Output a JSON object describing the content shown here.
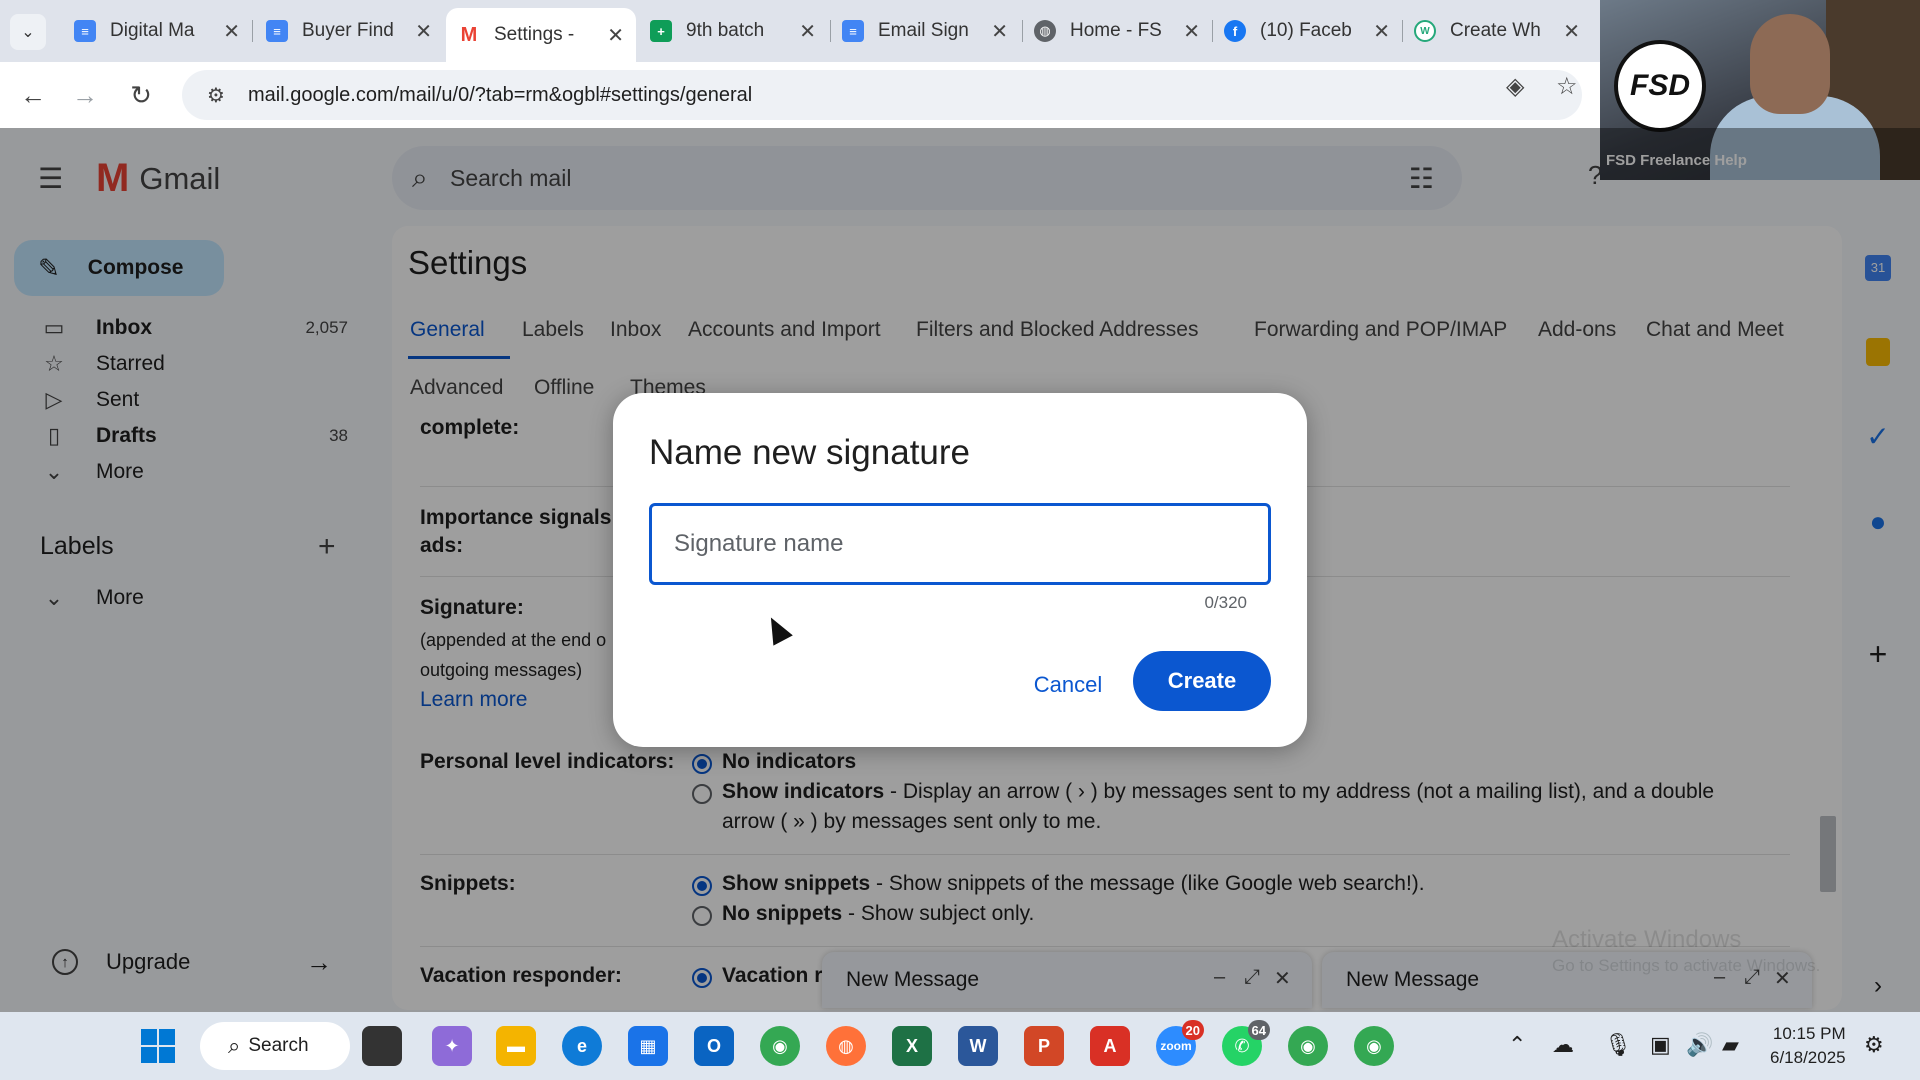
{
  "browser": {
    "tabs": [
      {
        "label": "Digital Ma",
        "icon": "docs-icon",
        "color": "#4285f4"
      },
      {
        "label": "Buyer Find",
        "icon": "docs-icon",
        "color": "#4285f4"
      },
      {
        "label": "Settings - ",
        "icon": "gmail-icon",
        "color": "#ea4335"
      },
      {
        "label": "9th batch ",
        "icon": "sheets-icon",
        "color": "#0f9d58"
      },
      {
        "label": "Email Sign",
        "icon": "docs-icon",
        "color": "#4285f4"
      },
      {
        "label": "Home - FS",
        "icon": "globe-icon",
        "color": "#5f6368"
      },
      {
        "label": "(10) Faceb",
        "icon": "facebook-icon",
        "color": "#1877f2"
      },
      {
        "label": "Create Wh",
        "icon": "wa-icon",
        "color": "#25a87a"
      }
    ],
    "url": "mail.google.com/mail/u/0/?tab=rm&ogbl#settings/general"
  },
  "gmail": {
    "logo_text": "Gmail",
    "search_placeholder": "Search mail",
    "compose_label": "Compose",
    "nav": [
      {
        "label": "Inbox",
        "count": "2,057",
        "icon": "inbox-icon"
      },
      {
        "label": "Starred",
        "count": "",
        "icon": "star-icon"
      },
      {
        "label": "Sent",
        "count": "",
        "icon": "send-icon"
      },
      {
        "label": "Drafts",
        "count": "38",
        "icon": "draft-icon"
      },
      {
        "label": "More",
        "count": "",
        "icon": "chevron-down-icon"
      }
    ],
    "labels_heading": "Labels",
    "labels_more": "More",
    "upgrade_label": "Upgrade"
  },
  "settings": {
    "title": "Settings",
    "tabs": [
      "General",
      "Labels",
      "Inbox",
      "Accounts and Import",
      "Filters and Blocked Addresses",
      "Forwarding and POP/IMAP",
      "Add-ons",
      "Chat and Meet"
    ],
    "tabs_row2": [
      "Advanced",
      "Offline",
      "Themes"
    ],
    "rows": {
      "complete_label": "complete:",
      "importance_label": "Importance signals",
      "importance_label2": "ads:",
      "signature_label": "Signature:",
      "signature_sub1": "(appended at the end o",
      "signature_sub2": "outgoing messages)",
      "signature_learn": "Learn more",
      "pli_label": "Personal level indicators:",
      "pli_opt1": "No indicators",
      "pli_opt2_b": "Show indicators",
      "pli_opt2_rest": " - Display an arrow ( › ) by messages sent to my address (not a mailing list), and a double",
      "pli_opt2_line2": "arrow ( » ) by messages sent only to me.",
      "snippets_label": "Snippets:",
      "snip_opt1_b": "Show snippets",
      "snip_opt1_rest": " - Show snippets of the message (like Google web search!).",
      "snip_opt2_b": "No snippets",
      "snip_opt2_rest": " - Show subject only.",
      "vacation_label": "Vacation responder:",
      "vacation_opt": "Vacation r"
    }
  },
  "compose_windows": [
    {
      "title": "New Message"
    },
    {
      "title": "New Message"
    }
  ],
  "watermark": {
    "line1": "Activate Windows",
    "line2": "Go to Settings to activate Windows."
  },
  "webcam": {
    "caption": "FSD Freelance Help",
    "logo_text": "FSD"
  },
  "dialog": {
    "title": "Name new signature",
    "input_placeholder": "Signature name",
    "input_value": "",
    "counter": "0/320",
    "cancel_label": "Cancel",
    "create_label": "Create"
  },
  "taskbar": {
    "search_label": "Search",
    "zoom_badge": "20",
    "whatsapp_badge": "64",
    "time": "10:15 PM",
    "date": "6/18/2025"
  },
  "colors": {
    "accent": "#0b57d0",
    "compose_bg": "#c2e7ff"
  }
}
